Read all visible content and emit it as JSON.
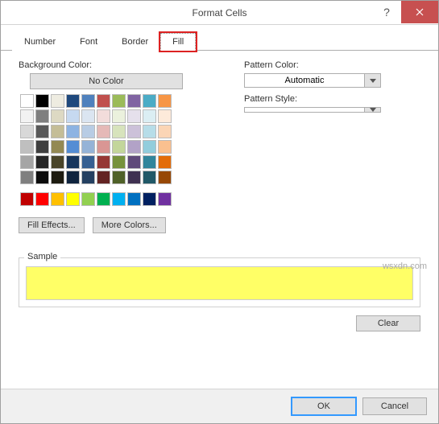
{
  "title": "Format Cells",
  "tabs": [
    "Number",
    "Font",
    "Border",
    "Fill"
  ],
  "active_tab": "Fill",
  "bg_color_label": "Background Color:",
  "no_color_label": "No Color",
  "theme_colors": [
    [
      "#ffffff",
      "#000000",
      "#eeece1",
      "#1f497d",
      "#4f81bd",
      "#c0504d",
      "#9bbb59",
      "#8064a2",
      "#4bacc6",
      "#f79646"
    ],
    [
      "#f2f2f2",
      "#7f7f7f",
      "#ddd9c3",
      "#c6d9f0",
      "#dbe5f1",
      "#f2dcdb",
      "#ebf1dd",
      "#e5e0ec",
      "#dbeef3",
      "#fdeada"
    ],
    [
      "#d8d8d8",
      "#595959",
      "#c4bd97",
      "#8db3e2",
      "#b8cce4",
      "#e5b9b7",
      "#d7e3bc",
      "#ccc1d9",
      "#b7dde8",
      "#fbd5b5"
    ],
    [
      "#bfbfbf",
      "#3f3f3f",
      "#938953",
      "#548dd4",
      "#95b3d7",
      "#d99694",
      "#c3d69b",
      "#b2a2c7",
      "#92cddc",
      "#fac08f"
    ],
    [
      "#a5a5a5",
      "#262626",
      "#494429",
      "#17365d",
      "#366092",
      "#953734",
      "#76923c",
      "#5f497a",
      "#31859b",
      "#e36c09"
    ],
    [
      "#7f7f7f",
      "#0c0c0c",
      "#1d1b10",
      "#0f243e",
      "#244061",
      "#632423",
      "#4f6128",
      "#3f3151",
      "#205867",
      "#974806"
    ]
  ],
  "standard_colors": [
    "#c00000",
    "#ff0000",
    "#ffc000",
    "#ffff00",
    "#92d050",
    "#00b050",
    "#00b0f0",
    "#0070c0",
    "#002060",
    "#7030a0"
  ],
  "fill_effects_label": "Fill Effects...",
  "more_colors_label": "More Colors...",
  "pattern_color_label": "Pattern Color:",
  "pattern_color_value": "Automatic",
  "pattern_style_label": "Pattern Style:",
  "pattern_style_value": "",
  "sample_label": "Sample",
  "sample_color": "#ffff66",
  "clear_label": "Clear",
  "ok_label": "OK",
  "cancel_label": "Cancel",
  "watermark": "wsxdn.com"
}
